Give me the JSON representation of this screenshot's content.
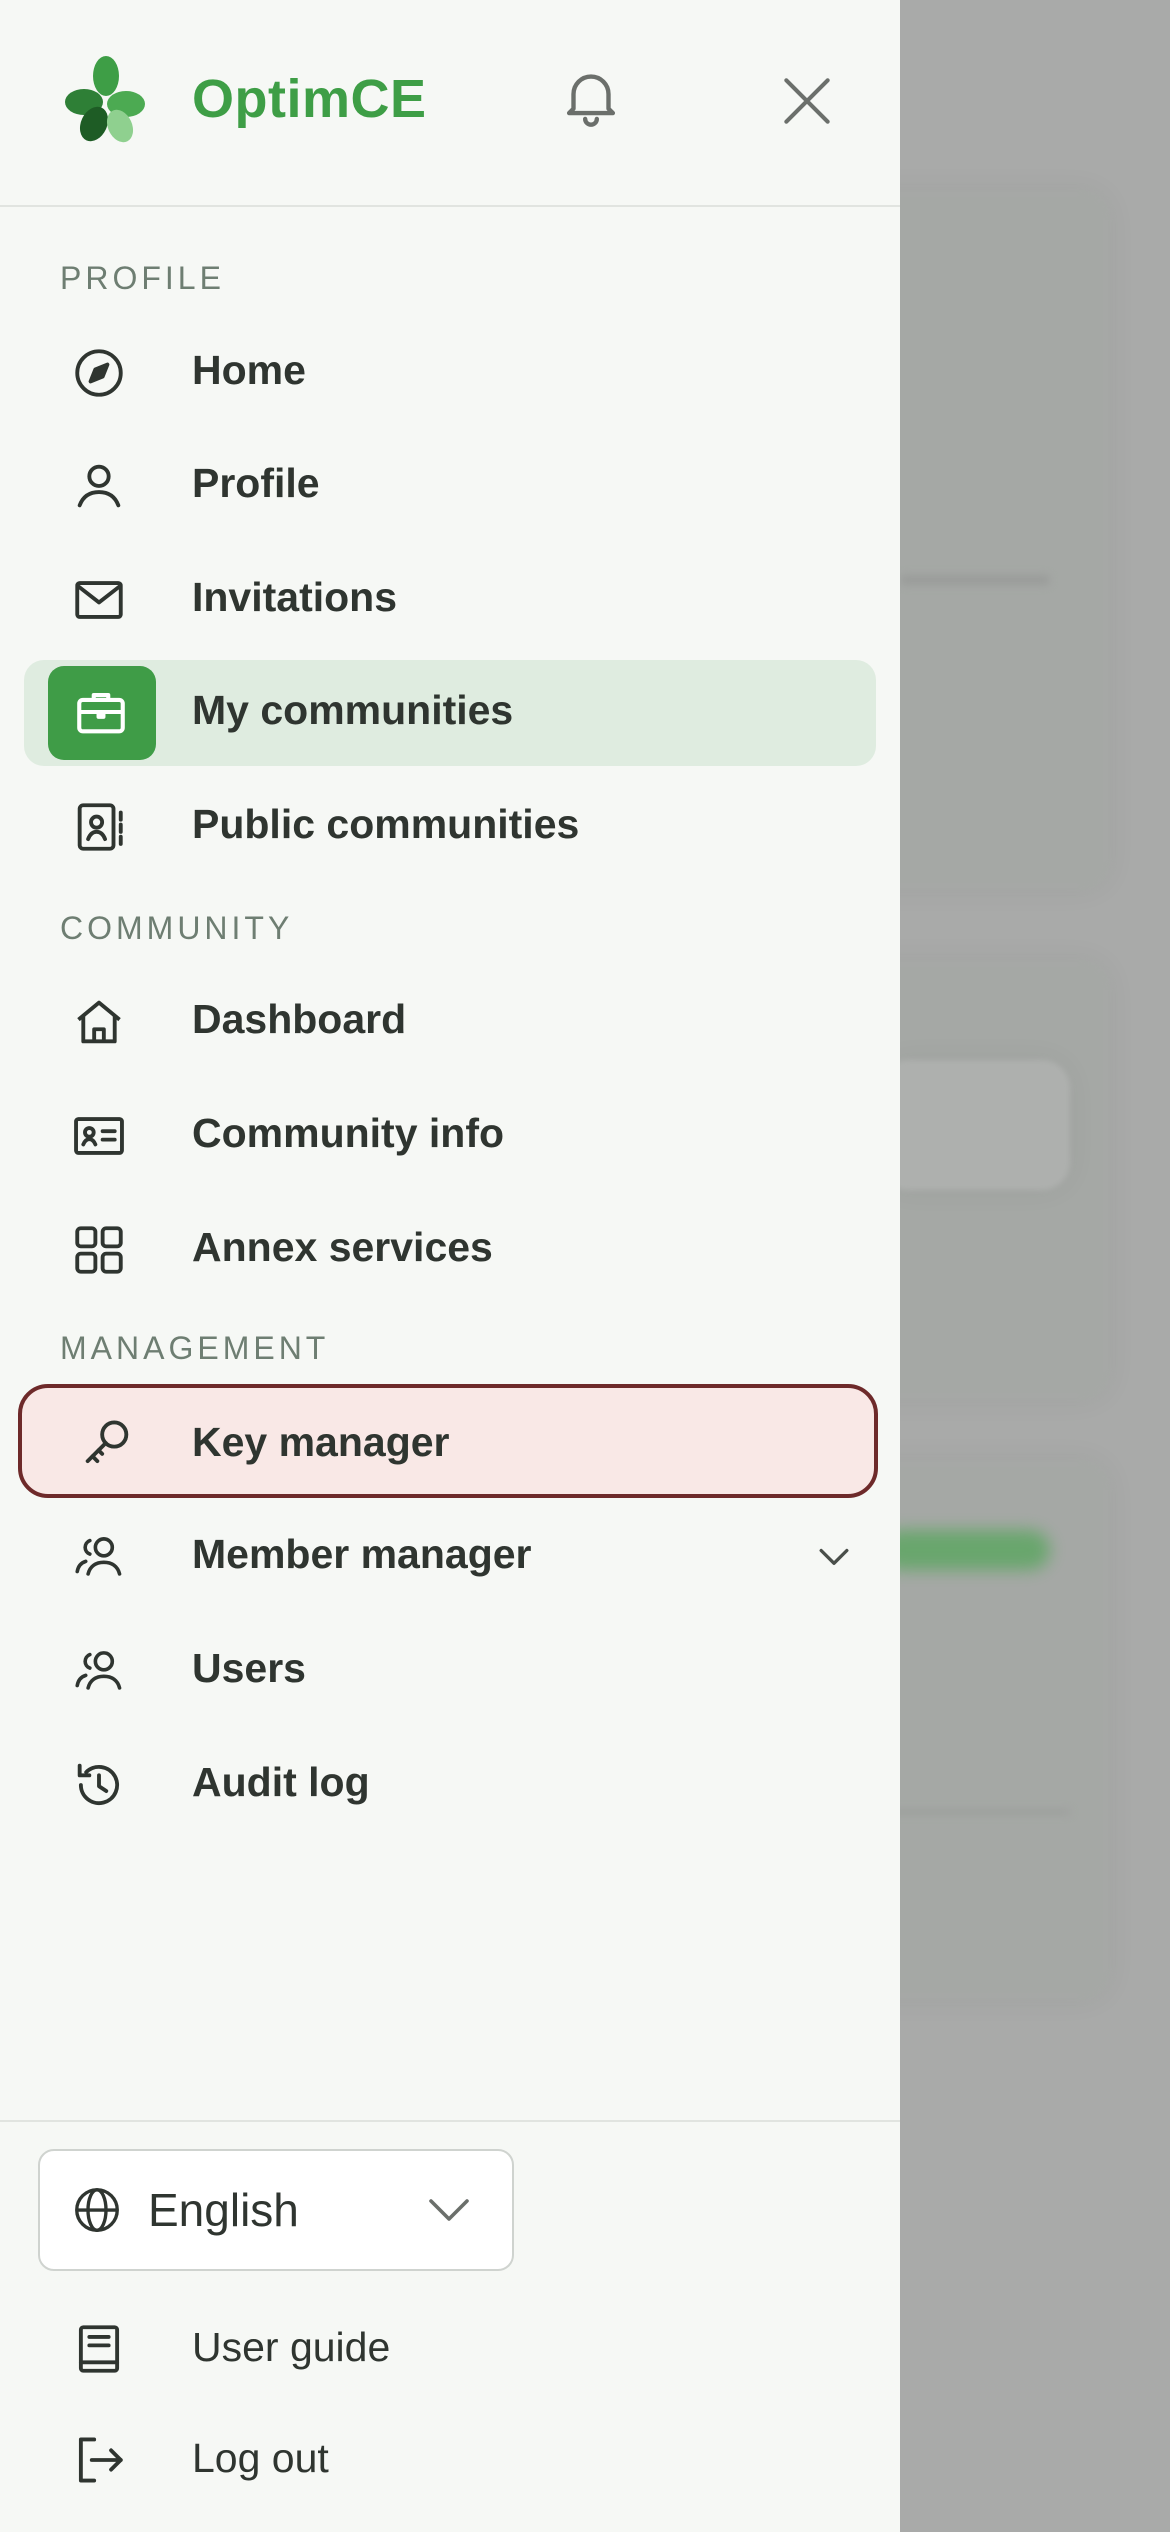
{
  "brand": {
    "name": "OptimCE"
  },
  "sections": {
    "profile": "PROFILE",
    "community": "COMMUNITY",
    "management": "MANAGEMENT"
  },
  "nav": {
    "home": "Home",
    "profile": "Profile",
    "invitations": "Invitations",
    "my_communities": "My communities",
    "public_communities": "Public communities",
    "dashboard": "Dashboard",
    "community_info": "Community info",
    "annex_services": "Annex services",
    "key_manager": "Key manager",
    "member_manager": "Member manager",
    "users": "Users",
    "audit_log": "Audit log"
  },
  "language": {
    "selected": "English"
  },
  "footer": {
    "user_guide": "User guide",
    "log_out": "Log out"
  },
  "colors": {
    "accent": "#3f9c47",
    "active_bg": "#dfece0",
    "danger_border": "#6e2a2a",
    "danger_bg": "#f9e8e6"
  },
  "icons": {
    "home": "compass-icon",
    "profile": "user-icon",
    "invitations": "mail-icon",
    "my_communities": "briefcase-icon",
    "public_communities": "contact-book-icon",
    "dashboard": "house-icon",
    "community_info": "id-card-icon",
    "annex_services": "grid-icon",
    "key_manager": "key-icon",
    "member_manager": "users-icon",
    "users": "users-icon",
    "audit_log": "history-icon"
  }
}
